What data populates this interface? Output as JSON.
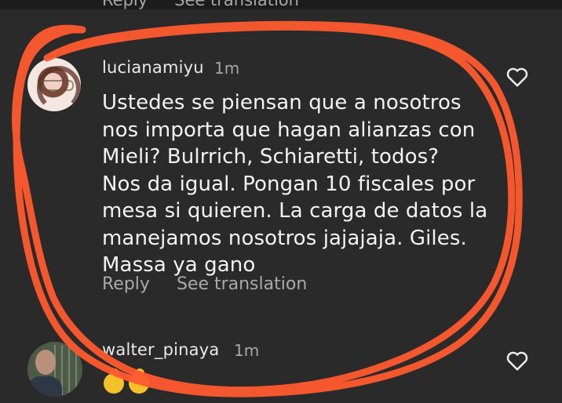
{
  "top_remnant": {
    "reply": "Reply",
    "see_translation": "See translation"
  },
  "comment1": {
    "username": "lucianamiyu",
    "time": "1m",
    "lines": [
      "Ustedes se piensan que a nosotros",
      "nos importa que hagan alianzas con",
      "Mieli? Bulrrich, Schiaretti, todos?",
      "Nos da igual. Pongan 10 fiscales por",
      "mesa si quieren. La carga de datos la",
      "manejamos nosotros jajajaja. Giles.",
      "Massa ya gano"
    ],
    "reply_label": "Reply",
    "see_translation_label": "See translation",
    "like_icon": "heart-outline-icon"
  },
  "comment2": {
    "username": "walter_pinaya",
    "time": "1m",
    "emoji": "🥭",
    "like_icon": "heart-outline-icon"
  },
  "colors": {
    "background": "#262626",
    "annotation": "#ff5a2e",
    "secondary_text": "#a7a7a7"
  }
}
